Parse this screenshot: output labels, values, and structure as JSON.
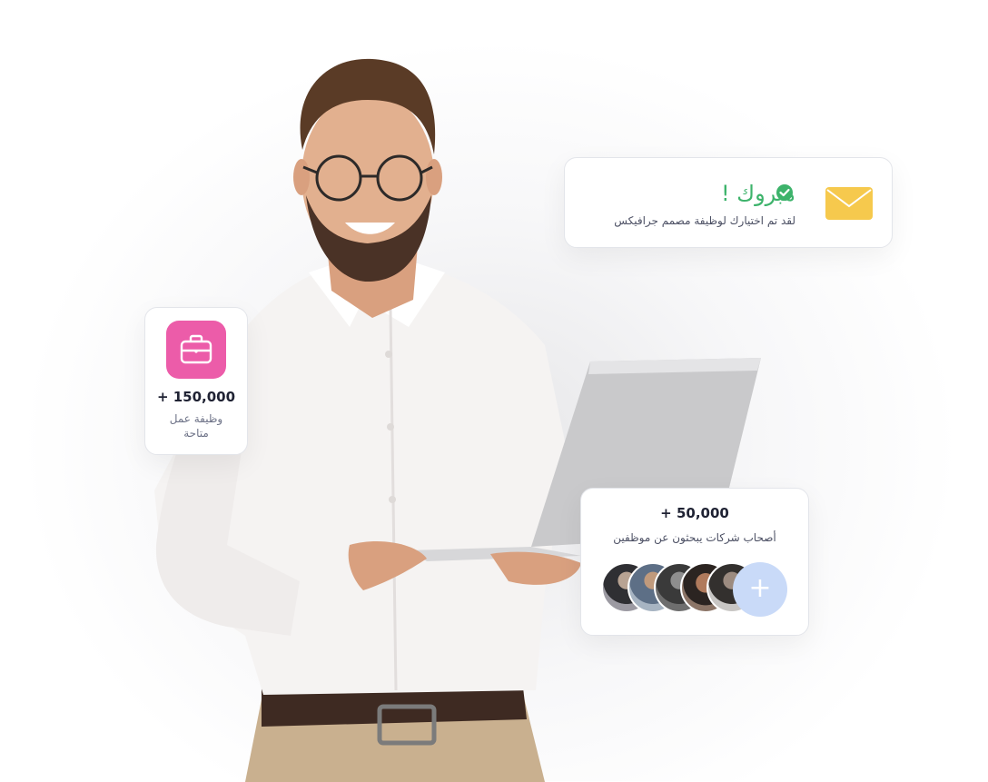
{
  "congrats": {
    "title": "مبروك !",
    "message": "لقد تم اختيارك لوظيفة مصمم جرافيكس"
  },
  "jobs": {
    "count": "150,000 +",
    "label": "وظيفة عمل متاحة"
  },
  "employers": {
    "count": "50,000 +",
    "label": "أصحاب شركات يبحثون عن موظفين",
    "add_symbol": "+"
  },
  "colors": {
    "success": "#3db36b",
    "briefcase_tile": "#ec5ca9",
    "mail": "#f6c94d",
    "add_avatar": "#c9daf8"
  },
  "icons": [
    "mail-icon",
    "check-circle-icon",
    "briefcase-icon",
    "plus-icon"
  ]
}
